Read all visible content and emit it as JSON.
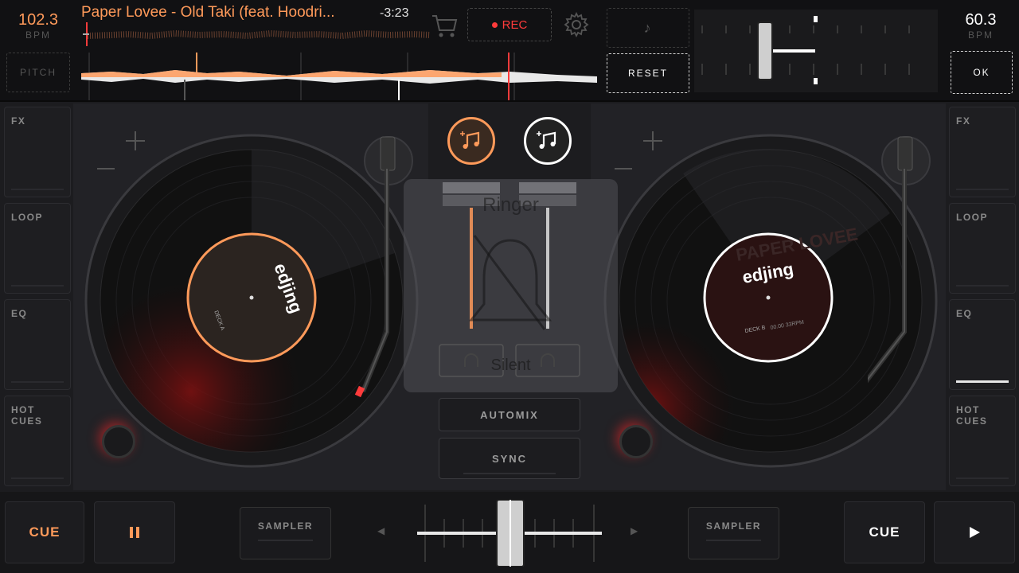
{
  "deck_a": {
    "bpm": "102.3",
    "bpm_label": "BPM",
    "pitch_label": "PITCH",
    "track_title": "Paper Lovee - Old Taki (feat. Hoodri...",
    "time_remaining": "-3:23",
    "accent_color": "#ff9a5a",
    "side_buttons": [
      {
        "label": "FX"
      },
      {
        "label": "LOOP"
      },
      {
        "label": "EQ"
      },
      {
        "label": "HOT\nCUES"
      }
    ],
    "cue_label": "CUE",
    "play_icon": "pause-icon",
    "sampler_label": "SAMPLER",
    "label_brand": "edjing",
    "label_deck": "DECK A"
  },
  "deck_b": {
    "bpm": "60.3",
    "bpm_label": "BPM",
    "ok_label": "OK",
    "reset_label": "RESET",
    "side_buttons": [
      {
        "label": "FX"
      },
      {
        "label": "LOOP"
      },
      {
        "label": "EQ"
      },
      {
        "label": "HOT\nCUES"
      }
    ],
    "cue_label": "CUE",
    "play_icon": "play-icon",
    "sampler_label": "SAMPLER",
    "label_brand": "edjing",
    "label_deck": "DECK B",
    "label_text": "PAPER LOVEE",
    "label_bpm": "00.00 33RPM",
    "accent_color": "#ffffff"
  },
  "header": {
    "rec_label": "REC",
    "rec_color": "#ff3b3b"
  },
  "mixer": {
    "ringer_label": "Ringer",
    "silent_label": "Silent",
    "automix_label": "AUTOMIX",
    "sync_label": "SYNC",
    "crossfader_left": "◀",
    "crossfader_right": "▶"
  }
}
